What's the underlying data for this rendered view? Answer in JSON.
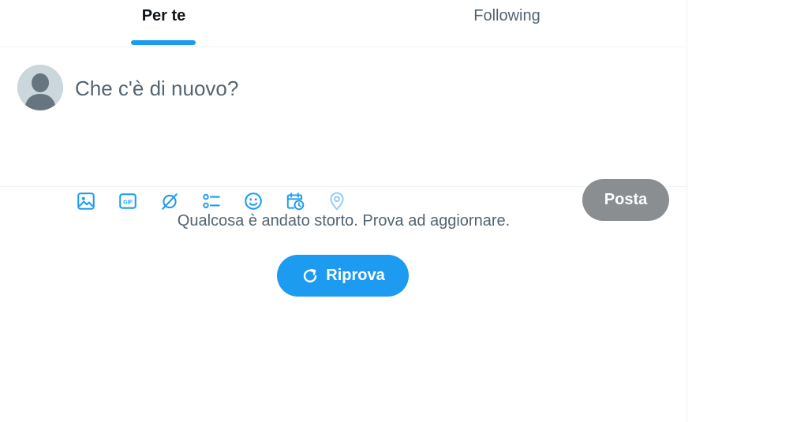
{
  "tabs": [
    {
      "label": "Per te",
      "selected": true
    },
    {
      "label": "Following",
      "selected": false
    }
  ],
  "composer": {
    "placeholder": "Che c'è di nuovo?",
    "post_label": "Posta",
    "tools": [
      "image-icon",
      "gif-icon",
      "grok-icon",
      "poll-icon",
      "emoji-icon",
      "schedule-icon",
      "location-icon"
    ]
  },
  "error": {
    "message": "Qualcosa è andato storto. Prova ad aggiornare.",
    "retry_label": "Riprova"
  },
  "colors": {
    "accent": "#1d9bf0",
    "post_button_disabled": "#8b8e90",
    "secondary_text": "#536471",
    "primary_text": "#0f1419"
  }
}
